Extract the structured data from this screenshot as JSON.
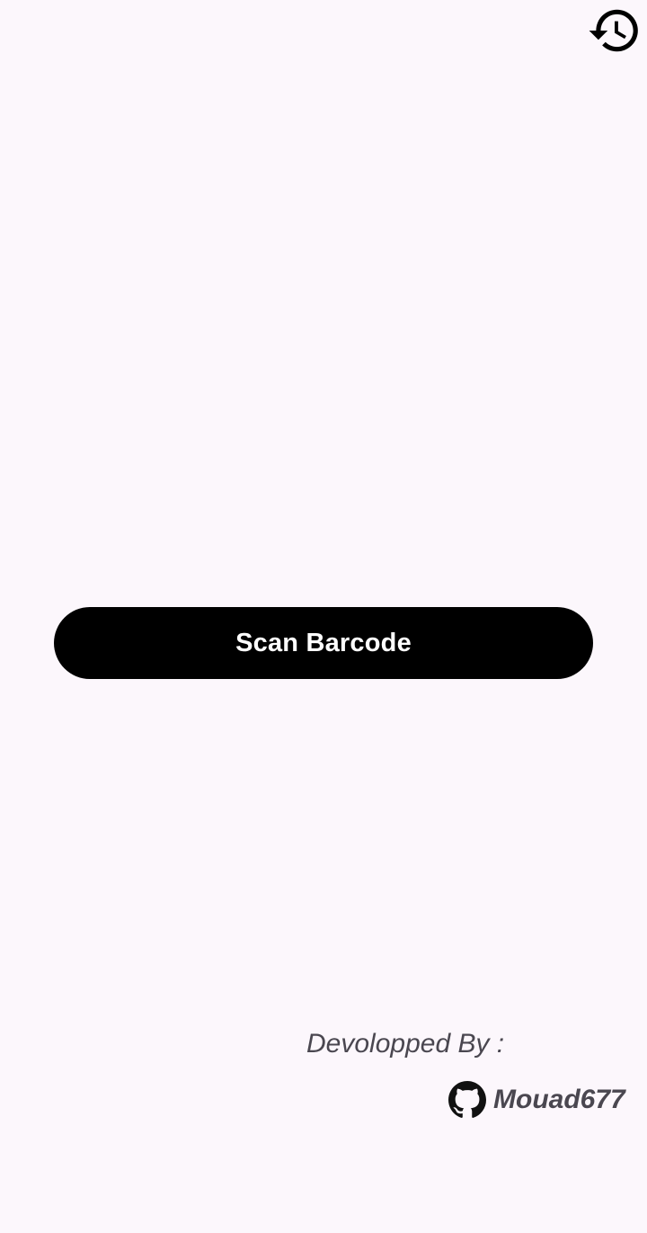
{
  "header": {
    "history_icon": "history-icon"
  },
  "main": {
    "scan_button_label": "Scan Barcode"
  },
  "footer": {
    "credit_label": "Devolopped By :",
    "author_name": "Mouad677",
    "author_icon": "github-icon"
  },
  "colors": {
    "background": "#fcf7fc",
    "button": "#000000",
    "button_text": "#ffffff",
    "footer_text": "#4a4750"
  }
}
